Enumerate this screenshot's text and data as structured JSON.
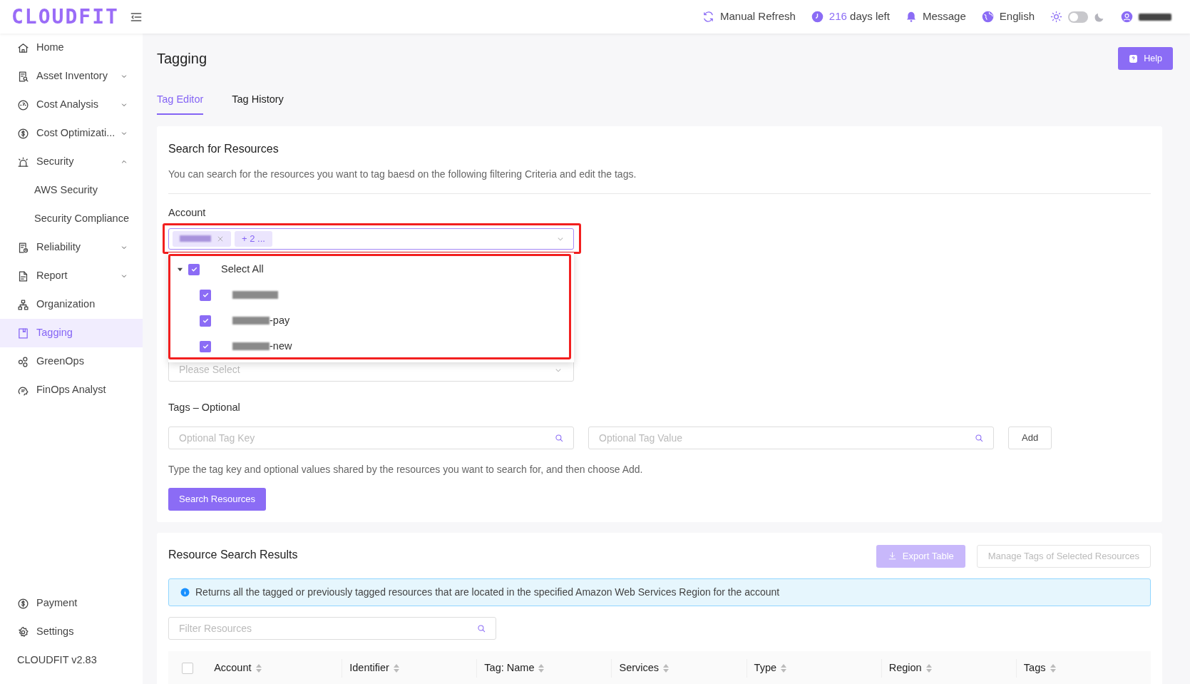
{
  "header": {
    "logo": "CLOUDFIT",
    "refresh": "Manual Refresh",
    "days_count": "216",
    "days_label": "days left",
    "message": "Message",
    "language": "English",
    "dark_mode": false
  },
  "sidebar": {
    "items": [
      {
        "label": "Home",
        "selected": false
      },
      {
        "label": "Asset Inventory",
        "expanded": false,
        "selected": false
      },
      {
        "label": "Cost Analysis",
        "expanded": false,
        "selected": false
      },
      {
        "label": "Cost Optimizati...",
        "expanded": false,
        "selected": false
      },
      {
        "label": "Security",
        "expanded": true,
        "selected": false,
        "children": [
          {
            "label": "AWS Security",
            "selected": false
          },
          {
            "label": "Security Compliance",
            "selected": false
          }
        ]
      },
      {
        "label": "Reliability",
        "expanded": false,
        "selected": false
      },
      {
        "label": "Report",
        "expanded": false,
        "selected": false
      },
      {
        "label": "Organization",
        "selected": false
      },
      {
        "label": "Tagging",
        "selected": true
      },
      {
        "label": "GreenOps",
        "selected": false
      },
      {
        "label": "FinOps Analyst",
        "selected": false
      }
    ],
    "footer_items": [
      {
        "label": "Payment"
      },
      {
        "label": "Settings"
      }
    ],
    "version": "CLOUDFIT v2.83"
  },
  "page": {
    "title": "Tagging",
    "help": "Help",
    "tabs": [
      {
        "label": "Tag Editor",
        "selected": true
      },
      {
        "label": "Tag History",
        "selected": false
      }
    ]
  },
  "search_card": {
    "title": "Search for Resources",
    "description": "You can search for the resources you want to tag baesd on the following filtering Criteria and edit the tags.",
    "account": {
      "label": "Account",
      "more_chip": "+ 2 ...",
      "select_all": {
        "label": "Select All",
        "checked": true
      },
      "options": [
        {
          "checked": true
        },
        {
          "label": "-pay",
          "checked": true
        },
        {
          "label": "-new",
          "checked": true
        }
      ]
    },
    "second_select": {
      "placeholder": "Please Select"
    },
    "tags_label": "Tags – Optional",
    "tag_key": {
      "placeholder": "Optional Tag Key"
    },
    "tag_value": {
      "placeholder": "Optional Tag Value"
    },
    "add": "Add",
    "hint": "Type the tag key and optional values shared by the resources you want to search for, and then choose Add.",
    "search_button": "Search Resources"
  },
  "results_card": {
    "title": "Resource Search Results",
    "export": "Export Table",
    "manage": "Manage Tags of Selected Resources",
    "alert": "Returns all the tagged or previously tagged resources that are located in the specified Amazon Web Services Region for the account",
    "filter": {
      "placeholder": "Filter Resources"
    },
    "select_all_checked": false,
    "columns": [
      "Account",
      "Identifier",
      "Tag: Name",
      "Services",
      "Type",
      "Region",
      "Tags"
    ]
  }
}
